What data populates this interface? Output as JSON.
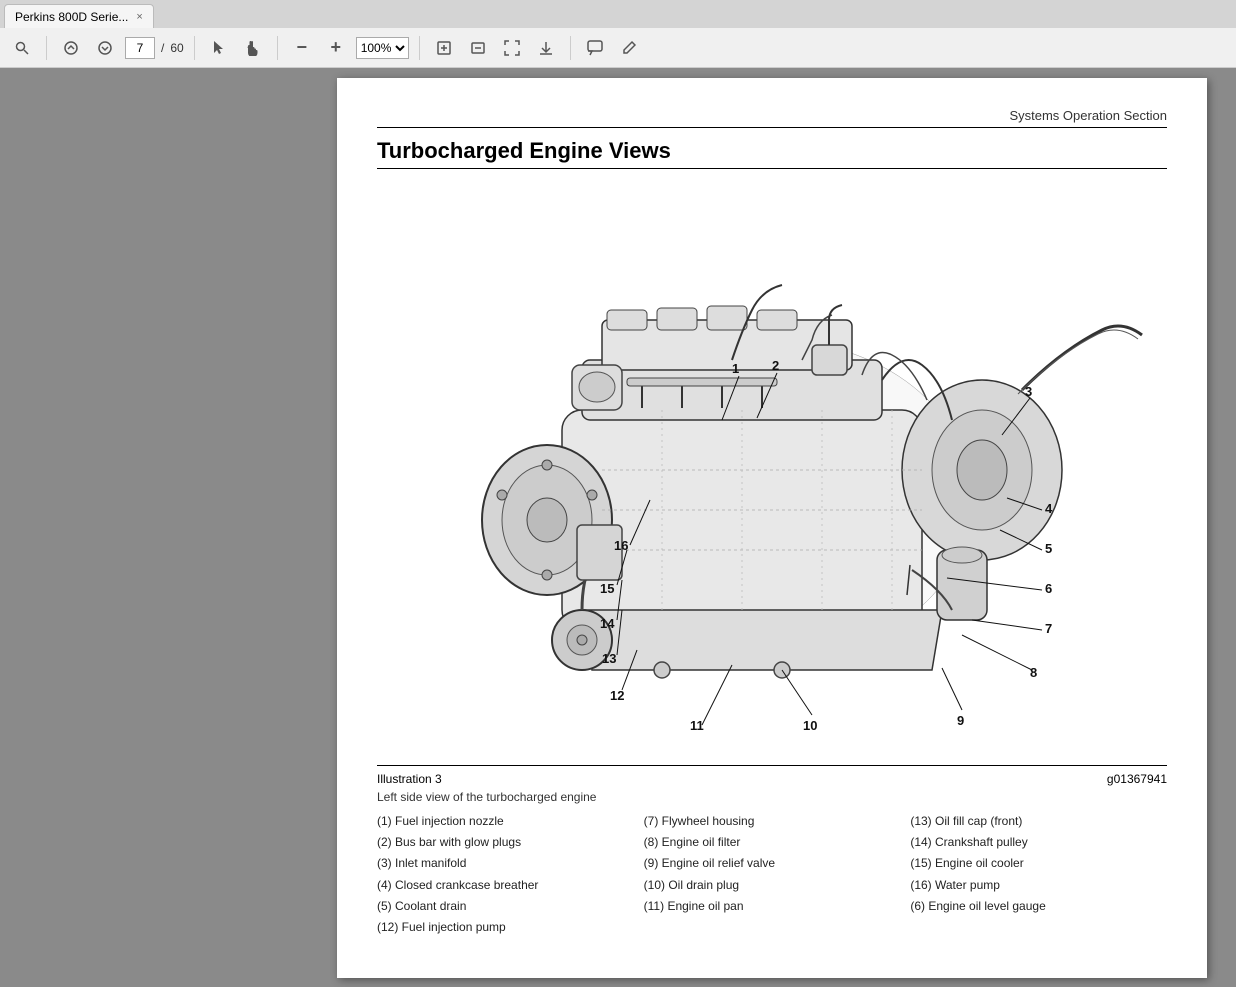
{
  "tab": {
    "title": "Perkins 800D Serie...",
    "close": "×"
  },
  "toolbar": {
    "search_icon": "🔍",
    "up_icon": "↑",
    "down_icon": "↓",
    "page_current": "7",
    "page_sep": "/",
    "page_total": "60",
    "cursor_icon": "↖",
    "hand_icon": "✋",
    "zoom_out_icon": "−",
    "zoom_in_icon": "+",
    "zoom_value": "100%",
    "fit_page_icon": "⊞",
    "fit_width_icon": "⊟",
    "full_screen_icon": "⤢",
    "download_icon": "⬇",
    "comment_icon": "💬",
    "edit_icon": "✏"
  },
  "page": {
    "section_header": "Systems Operation Section",
    "title": "Turbocharged Engine Views",
    "illustration_label": "Illustration 3",
    "illustration_id": "g01367941",
    "caption_desc": "Left side view of the turbocharged engine",
    "parts": [
      {
        "num": "(1)",
        "label": "Fuel injection nozzle"
      },
      {
        "num": "(7)",
        "label": "Flywheel housing"
      },
      {
        "num": "(13)",
        "label": "Oil fill cap (front)"
      },
      {
        "num": "(2)",
        "label": "Bus bar with glow plugs"
      },
      {
        "num": "(8)",
        "label": "Engine oil filter"
      },
      {
        "num": "(14)",
        "label": "Crankshaft pulley"
      },
      {
        "num": "(3)",
        "label": "Inlet manifold"
      },
      {
        "num": "(9)",
        "label": "Engine oil relief valve"
      },
      {
        "num": "(15)",
        "label": "Engine oil cooler"
      },
      {
        "num": "(4)",
        "label": "Closed crankcase breather"
      },
      {
        "num": "(10)",
        "label": "Oil drain plug"
      },
      {
        "num": "(16)",
        "label": "Water pump"
      },
      {
        "num": "(5)",
        "label": "Coolant drain"
      },
      {
        "num": "(11)",
        "label": "Engine oil pan"
      },
      {
        "num": "(6)",
        "label": "Engine oil level gauge"
      },
      {
        "num": "(12)",
        "label": "Fuel injection pump"
      }
    ]
  }
}
